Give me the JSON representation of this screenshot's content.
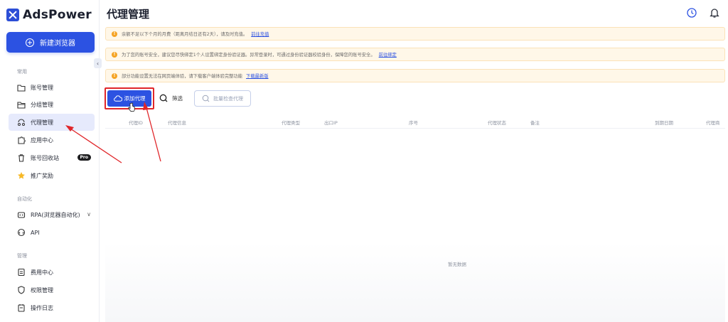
{
  "app": {
    "name": "AdsPower"
  },
  "sidebar": {
    "new_browser_label": "新建浏览器",
    "collapse_glyph": "‹",
    "sections": {
      "common": "常用",
      "automation": "自动化",
      "management": "管理"
    },
    "items": [
      {
        "label": "账号管理",
        "icon": "folder-icon"
      },
      {
        "label": "分组管理",
        "icon": "group-folder-icon"
      },
      {
        "label": "代理管理",
        "icon": "proxy-icon",
        "active": true
      },
      {
        "label": "应用中心",
        "icon": "puzzle-icon"
      },
      {
        "label": "账号回收站",
        "icon": "trash-icon",
        "badge": "Pro"
      },
      {
        "label": "推广奖励",
        "icon": "star-icon"
      },
      {
        "label": "RPA(浏览器自动化)",
        "icon": "robot-icon",
        "chevron": "∨"
      },
      {
        "label": "API",
        "icon": "api-icon"
      },
      {
        "label": "费用中心",
        "icon": "billing-icon"
      },
      {
        "label": "权限管理",
        "icon": "shield-icon"
      },
      {
        "label": "操作日志",
        "icon": "log-icon"
      }
    ]
  },
  "header": {
    "title": "代理管理"
  },
  "notices": [
    {
      "text": "余额不足以下个月的月费（距离月结日还有2天），请及时充值。",
      "link": "前往充值"
    },
    {
      "text": "为了您的账号安全，建议您尽快绑定1个人设置绑定身份验证器。异常登录时，可通过身份验证器校验身份，保障您的账号安全。",
      "link": "前往绑定"
    },
    {
      "text": "部分功能设置无法在网页端体验，请下载客户端体验完整功能",
      "link": "下载最新版"
    }
  ],
  "toolbar": {
    "add_proxy_label": "添加代理",
    "filter_label": "筛选",
    "batch_check_label": "批量检查代理"
  },
  "table": {
    "columns": [
      "代理ID",
      "代理信息",
      "代理类型",
      "出口IP",
      "序号",
      "代理状态",
      "备注",
      "到期日期",
      "代理商"
    ],
    "empty_text": "暂无数据"
  },
  "colors": {
    "brand": "#2c52e2",
    "notice_bg": "#fff7e8",
    "warning": "#f5a323",
    "annotation_red": "#e0262a"
  }
}
